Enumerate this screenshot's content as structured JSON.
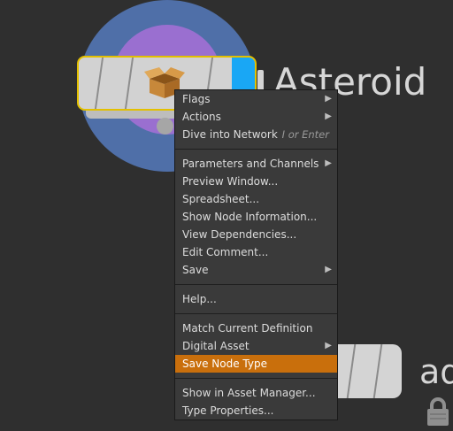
{
  "node": {
    "title": "Asteroid",
    "icon": "package-box-icon"
  },
  "second_node": {
    "label": "ad",
    "icon": "lock-icon"
  },
  "colors": {
    "background": "#2f2f2f",
    "selection_outline": "#e3c000",
    "node_flag_blue": "#19a7f5",
    "highlight": "#c96f0c"
  },
  "menu": {
    "items": [
      {
        "label": "Flags",
        "submenu": true
      },
      {
        "label": "Actions",
        "submenu": true
      },
      {
        "label": "Dive into Network",
        "shortcut": "I or Enter"
      },
      {
        "label": "Parameters and Channels",
        "submenu": true
      },
      {
        "label": "Preview Window..."
      },
      {
        "label": "Spreadsheet..."
      },
      {
        "label": "Show Node Information..."
      },
      {
        "label": "View Dependencies..."
      },
      {
        "label": "Edit Comment..."
      },
      {
        "label": "Save",
        "submenu": true
      },
      {
        "label": "Help..."
      },
      {
        "label": "Match Current Definition"
      },
      {
        "label": "Digital Asset",
        "submenu": true
      },
      {
        "label": "Save Node Type",
        "highlighted": true
      },
      {
        "label": "Show in Asset Manager..."
      },
      {
        "label": "Type Properties..."
      }
    ]
  }
}
